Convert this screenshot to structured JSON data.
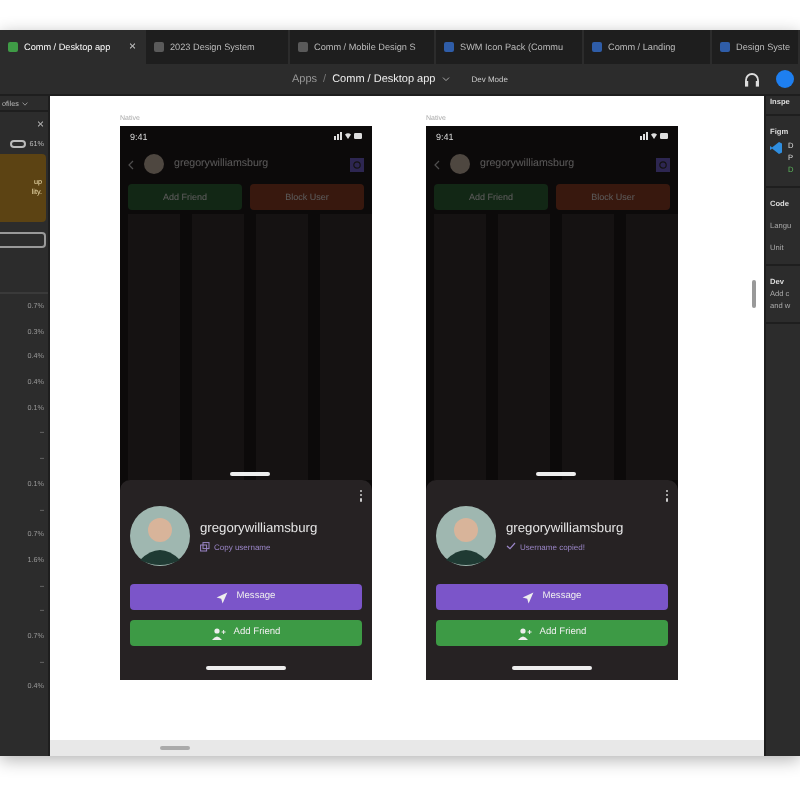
{
  "tabs": [
    {
      "label": "Comm / Desktop app",
      "selected": true,
      "color": "#3f9b46",
      "closable": true
    },
    {
      "label": "2023 Design System",
      "selected": false,
      "color": "#5a5a5a",
      "closable": false
    },
    {
      "label": "Comm / Mobile Design S",
      "selected": false,
      "color": "#5a5a5a",
      "closable": false
    },
    {
      "label": "SWM Icon Pack (Commu",
      "selected": false,
      "color": "#2f5da8",
      "closable": false
    },
    {
      "label": "Comm / Landing",
      "selected": false,
      "color": "#2f5da8",
      "closable": false
    },
    {
      "label": "Design Syste",
      "selected": false,
      "color": "#2f5da8",
      "closable": false
    }
  ],
  "close_glyph": "×",
  "toolbar": {
    "breadcrumb": "Apps",
    "separator": "/",
    "file": "Comm / Desktop app",
    "mode": "Dev Mode"
  },
  "left_panel": {
    "title": "ofiles",
    "close": "×",
    "toggle_on": false,
    "percent": "61%",
    "notice": [
      "up",
      "lity."
    ],
    "values": [
      "0.7%",
      "0.3%",
      "0.4%",
      "0.4%",
      "0.1%",
      "–",
      "–",
      "0.1%",
      "–",
      "0.7%",
      "1.6%",
      "–",
      "–",
      "0.7%",
      "–",
      "0.4%"
    ]
  },
  "frames": [
    {
      "label": "Native",
      "time": "9:41",
      "header_username": "gregorywilliamsburg",
      "username": "gregorywilliamsburg",
      "copied": false,
      "copy_text": "Copy username",
      "dim_buttons": [
        "Add Friend",
        "Block User"
      ],
      "message": "Message",
      "add_friend": "Add Friend"
    },
    {
      "label": "Native",
      "time": "9:41",
      "header_username": "gregorywilliamsburg",
      "username": "gregorywilliamsburg",
      "copied": true,
      "copy_text": "Username copied!",
      "dim_buttons": [
        "Add Friend",
        "Block User"
      ],
      "message": "Message",
      "add_friend": "Add Friend"
    }
  ],
  "right_panel": {
    "title": "Inspe",
    "plugin": {
      "title": "Figm",
      "lines": [
        "D",
        "P",
        "D"
      ]
    },
    "code_title": "Code",
    "rows": [
      "Langu",
      "Unit"
    ],
    "dev_title": "Dev",
    "dev_text": [
      "Add c",
      "and w"
    ]
  }
}
